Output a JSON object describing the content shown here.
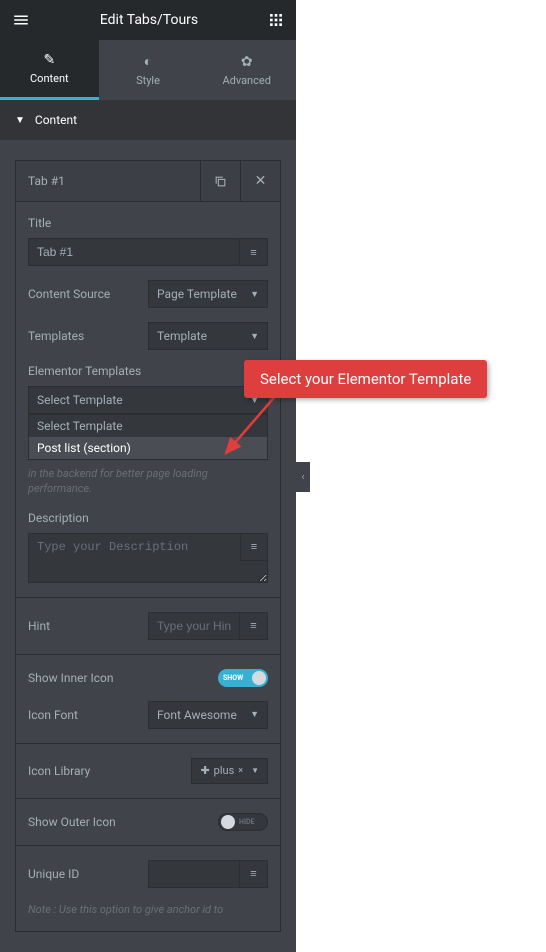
{
  "header": {
    "title": "Edit Tabs/Tours"
  },
  "tabs": {
    "content": "Content",
    "style": "Style",
    "advanced": "Advanced"
  },
  "section": {
    "title": "Content"
  },
  "tabItem": {
    "title": "Tab #1"
  },
  "fields": {
    "titleLabel": "Title",
    "titleValue": "Tab #1",
    "contentSourceLabel": "Content Source",
    "contentSourceValue": "Page Template",
    "templatesLabel": "Templates",
    "templatesValue": "Template",
    "elTemplatesLabel": "Elementor Templates",
    "elTemplatesSelected": "Select Template",
    "elOptions": [
      "Select Template",
      "Post list (section)"
    ],
    "note": "in the backend for better page loading performance.",
    "descLabel": "Description",
    "descPlaceholder": "Type your Description",
    "hintLabel": "Hint",
    "hintPlaceholder": "Type your Hint",
    "showInnerLabel": "Show Inner Icon",
    "showInnerOn": "SHOW",
    "iconFontLabel": "Icon Font",
    "iconFontValue": "Font Awesome",
    "iconLibLabel": "Icon Library",
    "iconLibValue": "plus",
    "showOuterLabel": "Show Outer Icon",
    "showOuterOff": "HIDE",
    "uniqueIdLabel": "Unique ID",
    "footNote": "Note : Use this option to give anchor id to"
  },
  "callout": {
    "text": "Select your Elementor Template"
  }
}
